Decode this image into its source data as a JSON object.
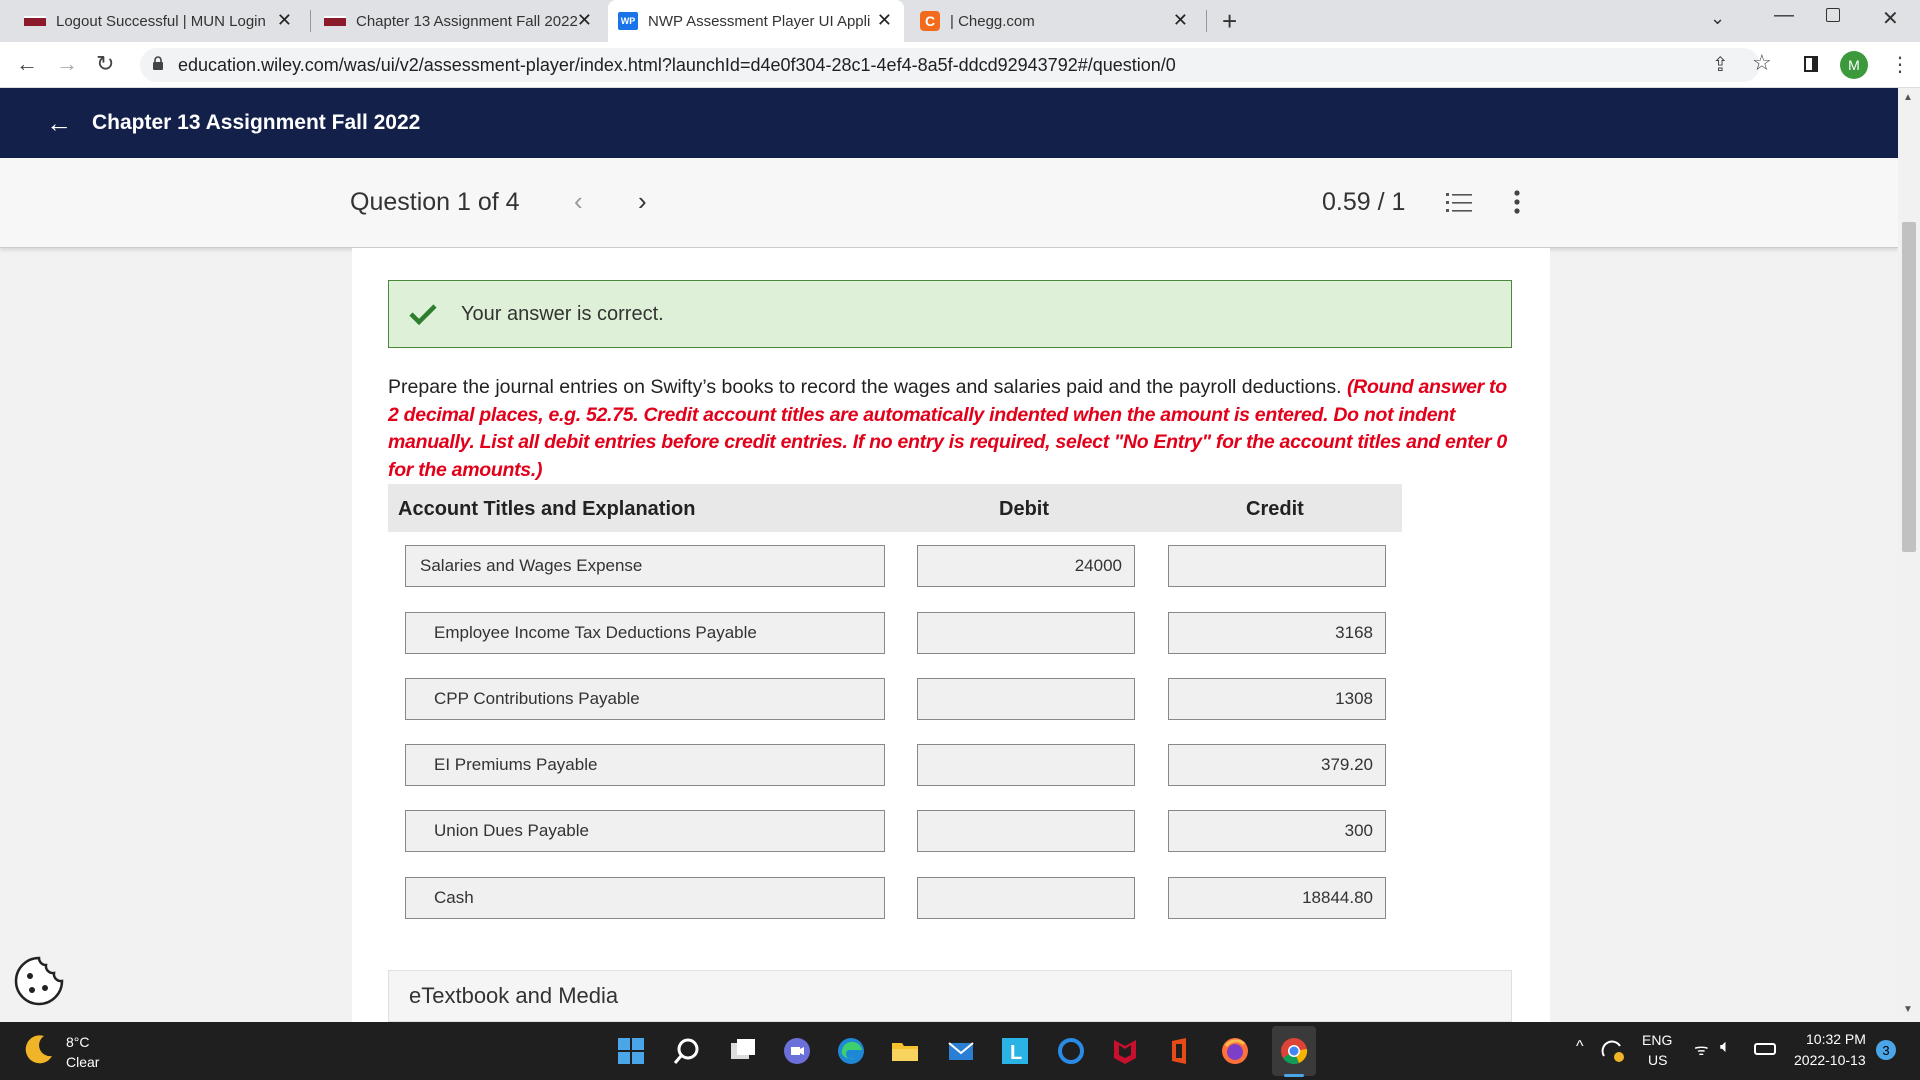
{
  "browser": {
    "tabs": [
      {
        "title": "Logout Successful | MUN Login"
      },
      {
        "title": "Chapter 13 Assignment Fall 2022"
      },
      {
        "title": "NWP Assessment Player UI Appli"
      },
      {
        "title": "| Chegg.com"
      }
    ],
    "new_tab": "+",
    "url": "education.wiley.com/was/ui/v2/assessment-player/index.html?launchId=d4e0f304-28c1-4ef4-8a5f-ddcd92943792#/question/0",
    "profile_initial": "M"
  },
  "app": {
    "title": "Chapter 13 Assignment Fall 2022"
  },
  "question_bar": {
    "label": "Question 1 of 4",
    "score": "0.59 / 1"
  },
  "feedback": {
    "message": "Your answer is correct."
  },
  "prompt": {
    "text": "Prepare the journal entries on Swifty’s books to record the wages and salaries paid and the payroll deductions. ",
    "instructions": "(Round answer to 2 decimal places, e.g. 52.75. Credit account titles are automatically indented when the amount is entered. Do not indent manually. List all debit entries before credit entries. If no entry is required, select \"No Entry\" for the account titles and enter 0 for the amounts.)"
  },
  "table": {
    "headers": {
      "account": "Account Titles and Explanation",
      "debit": "Debit",
      "credit": "Credit"
    },
    "rows": [
      {
        "account": "Salaries and Wages Expense",
        "debit": "24000",
        "credit": ""
      },
      {
        "account": "Employee Income Tax Deductions Payable",
        "debit": "",
        "credit": "3168"
      },
      {
        "account": "CPP Contributions Payable",
        "debit": "",
        "credit": "1308"
      },
      {
        "account": "EI Premiums Payable",
        "debit": "",
        "credit": "379.20"
      },
      {
        "account": "Union Dues Payable",
        "debit": "",
        "credit": "300"
      },
      {
        "account": "Cash",
        "debit": "",
        "credit": "18844.80"
      }
    ]
  },
  "etextbook": {
    "label": "eTextbook and Media"
  },
  "taskbar": {
    "weather_temp": "8°C",
    "weather_cond": "Clear",
    "lang_1": "ENG",
    "lang_2": "US",
    "time": "10:32 PM",
    "date": "2022-10-13",
    "notifications": "3"
  }
}
